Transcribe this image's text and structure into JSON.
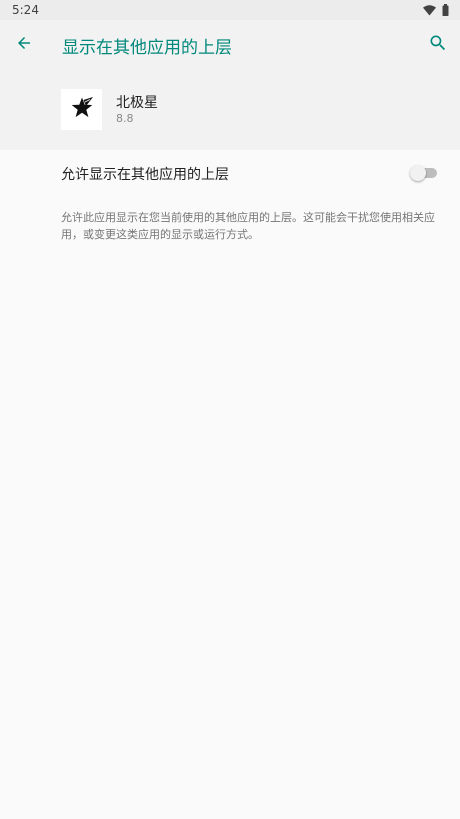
{
  "status_bar": {
    "time": "5:24",
    "icons": [
      "wifi-icon",
      "battery-icon"
    ]
  },
  "app_bar": {
    "title": "显示在其他应用的上层",
    "back_icon": "arrow-back-icon",
    "search_icon": "search-icon"
  },
  "app_info": {
    "name": "北极星",
    "version": "8.8",
    "icon": "star-logo-icon"
  },
  "preference": {
    "label": "允许显示在其他应用的上层",
    "enabled": false,
    "summary": "允许此应用显示在您当前使用的其他应用的上层。这可能会干扰您使用相关应用，或变更这类应用的显示或运行方式。"
  },
  "colors": {
    "accent": "#00897b",
    "background": "#fafafa",
    "header_background": "#f2f2f2"
  }
}
